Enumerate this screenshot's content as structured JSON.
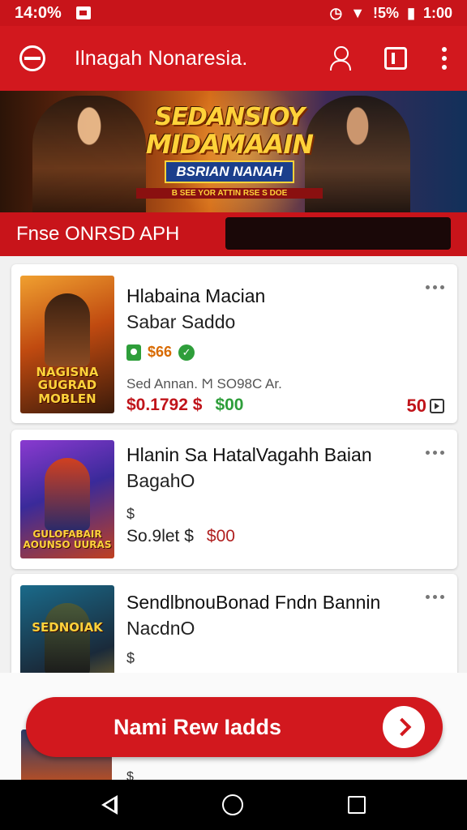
{
  "status_bar": {
    "time": "14:0%",
    "battery_text": "!5%",
    "clock": "1:00"
  },
  "app_bar": {
    "title": "Ilnagah Nonaresia."
  },
  "banner": {
    "title_line1": "SEDANSIOY",
    "title_line2": "MIDAMAAIN",
    "subtitle": "BSRIAN NANAH",
    "tagline": "B SEE YOR ATTIN RSE S DOE"
  },
  "section": {
    "title": "Fnse ONRSD APH"
  },
  "items": [
    {
      "title": "Hlabaina Macian",
      "subtitle": "Sabar Saddo",
      "price_tag": "$66",
      "meta": "Sed Annan. Ϻ SO98C Ar.",
      "price_red": "$0.1792 $",
      "price_green": "$00",
      "count": "50",
      "thumb_label": "NAGISNA GUGRAD MOBLEN"
    },
    {
      "title": "Hlanin Sa HatalVagahh Baian",
      "subtitle": "BagahO",
      "dollar": "$",
      "price_dark": "So.9let $",
      "price_darkred": "$00",
      "thumb_label": "GULOFABAIR AOUNSO UURAS"
    },
    {
      "title": "SendlbnouBonad Fndn Bannin",
      "subtitle": "NacdnO",
      "dollar": "$",
      "thumb_label": "SEDNOIAK"
    }
  ],
  "cta": {
    "label": "Nami Rew Iadds"
  },
  "colors": {
    "primary": "#d2181e",
    "green": "#2e9e3a",
    "price_red": "#c0141a"
  },
  "icons": [
    "app-logo-icon",
    "user-icon",
    "cart-icon",
    "more-icon",
    "chevron-right-icon",
    "back-icon",
    "home-icon",
    "recents-icon"
  ]
}
